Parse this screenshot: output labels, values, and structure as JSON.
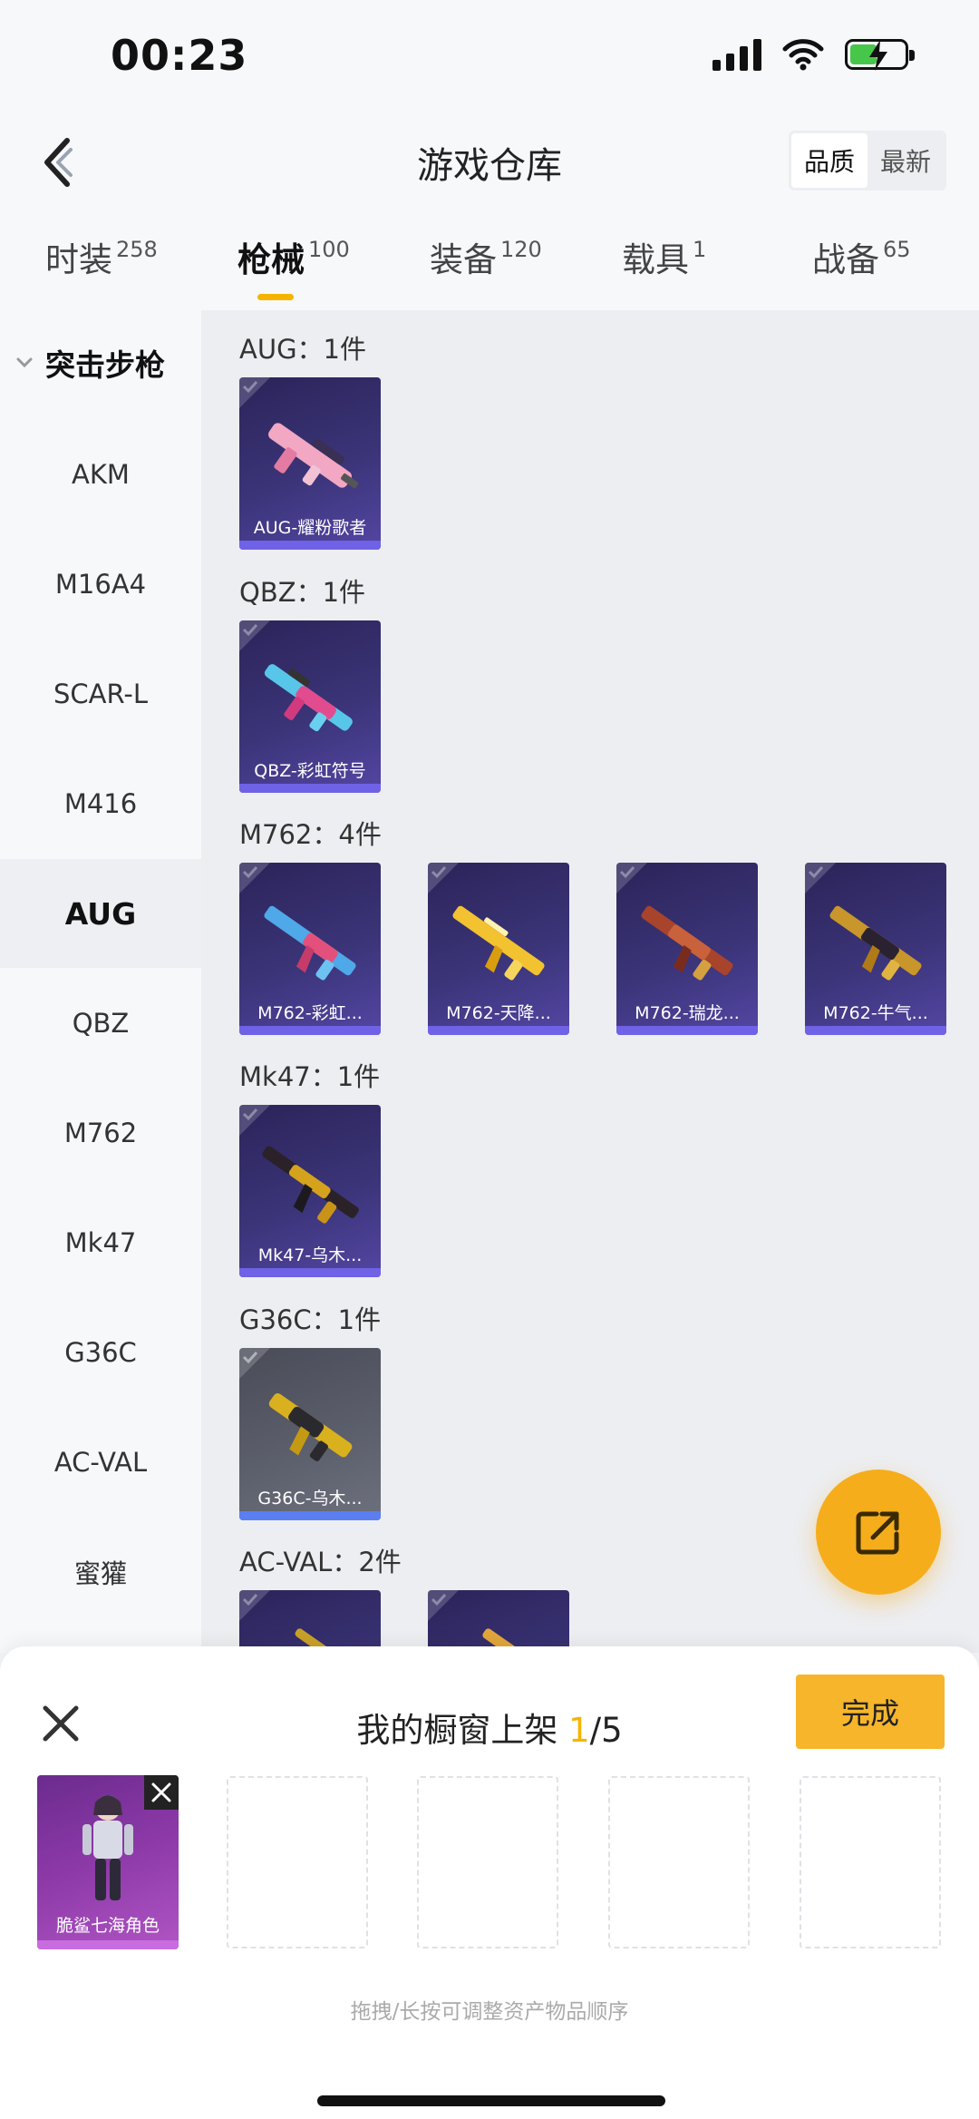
{
  "status_bar": {
    "time": "00:23"
  },
  "header": {
    "title": "游戏仓库",
    "sort_options": [
      "品质",
      "最新"
    ],
    "sort_selected": "品质"
  },
  "tabs": [
    {
      "label": "时装",
      "count": "258"
    },
    {
      "label": "枪械",
      "count": "100",
      "active": true
    },
    {
      "label": "装备",
      "count": "120"
    },
    {
      "label": "载具",
      "count": "1"
    },
    {
      "label": "战备",
      "count": "65"
    }
  ],
  "sidebar": {
    "category": "突击步枪",
    "items": [
      "AKM",
      "M16A4",
      "SCAR-L",
      "M416",
      "AUG",
      "QBZ",
      "M762",
      "Mk47",
      "G36C",
      "AC-VAL",
      "蜜獾"
    ],
    "active": "AUG"
  },
  "groups": [
    {
      "title": "AUG：1件",
      "items": [
        "AUG-耀粉歌者"
      ]
    },
    {
      "title": "QBZ：1件",
      "items": [
        "QBZ-彩虹符号"
      ]
    },
    {
      "title": "M762：4件",
      "items": [
        "M762-彩虹...",
        "M762-天降...",
        "M762-瑞龙...",
        "M762-牛气..."
      ]
    },
    {
      "title": "Mk47：1件",
      "items": [
        "Mk47-乌木..."
      ]
    },
    {
      "title": "G36C：1件",
      "items": [
        "G36C-乌木..."
      ]
    },
    {
      "title": "AC-VAL：2件",
      "items": []
    }
  ],
  "showcase": {
    "title_prefix": "我的橱窗上架 ",
    "count": "1",
    "total": "/5",
    "done_label": "完成",
    "filled_item": "脆鲨七海角色",
    "hint": "拖拽/长按可调整资产物品顺序"
  },
  "colors": {
    "accent": "#f5b400",
    "fab": "#f6ad1c",
    "card_purple": "#3b3478",
    "card_grey": "#5b5e6b",
    "role_purple": "#8e3aa9"
  }
}
